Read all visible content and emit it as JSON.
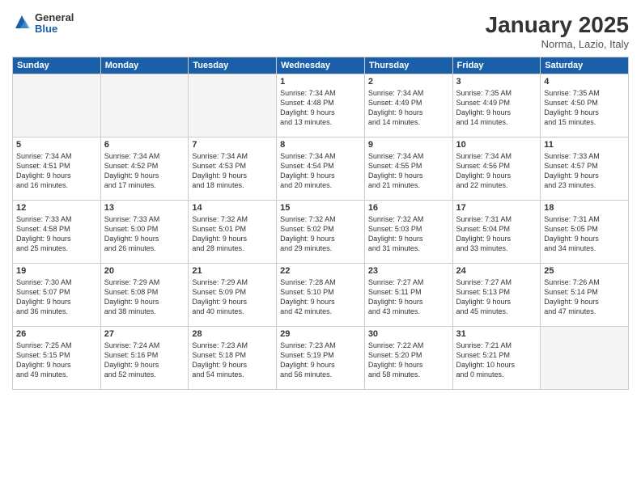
{
  "logo": {
    "general": "General",
    "blue": "Blue"
  },
  "title": "January 2025",
  "subtitle": "Norma, Lazio, Italy",
  "weekdays": [
    "Sunday",
    "Monday",
    "Tuesday",
    "Wednesday",
    "Thursday",
    "Friday",
    "Saturday"
  ],
  "weeks": [
    [
      {
        "day": "",
        "info": "",
        "empty": true
      },
      {
        "day": "",
        "info": "",
        "empty": true
      },
      {
        "day": "",
        "info": "",
        "empty": true
      },
      {
        "day": "1",
        "info": "Sunrise: 7:34 AM\nSunset: 4:48 PM\nDaylight: 9 hours\nand 13 minutes.",
        "empty": false
      },
      {
        "day": "2",
        "info": "Sunrise: 7:34 AM\nSunset: 4:49 PM\nDaylight: 9 hours\nand 14 minutes.",
        "empty": false
      },
      {
        "day": "3",
        "info": "Sunrise: 7:35 AM\nSunset: 4:49 PM\nDaylight: 9 hours\nand 14 minutes.",
        "empty": false
      },
      {
        "day": "4",
        "info": "Sunrise: 7:35 AM\nSunset: 4:50 PM\nDaylight: 9 hours\nand 15 minutes.",
        "empty": false
      }
    ],
    [
      {
        "day": "5",
        "info": "Sunrise: 7:34 AM\nSunset: 4:51 PM\nDaylight: 9 hours\nand 16 minutes.",
        "empty": false
      },
      {
        "day": "6",
        "info": "Sunrise: 7:34 AM\nSunset: 4:52 PM\nDaylight: 9 hours\nand 17 minutes.",
        "empty": false
      },
      {
        "day": "7",
        "info": "Sunrise: 7:34 AM\nSunset: 4:53 PM\nDaylight: 9 hours\nand 18 minutes.",
        "empty": false
      },
      {
        "day": "8",
        "info": "Sunrise: 7:34 AM\nSunset: 4:54 PM\nDaylight: 9 hours\nand 20 minutes.",
        "empty": false
      },
      {
        "day": "9",
        "info": "Sunrise: 7:34 AM\nSunset: 4:55 PM\nDaylight: 9 hours\nand 21 minutes.",
        "empty": false
      },
      {
        "day": "10",
        "info": "Sunrise: 7:34 AM\nSunset: 4:56 PM\nDaylight: 9 hours\nand 22 minutes.",
        "empty": false
      },
      {
        "day": "11",
        "info": "Sunrise: 7:33 AM\nSunset: 4:57 PM\nDaylight: 9 hours\nand 23 minutes.",
        "empty": false
      }
    ],
    [
      {
        "day": "12",
        "info": "Sunrise: 7:33 AM\nSunset: 4:58 PM\nDaylight: 9 hours\nand 25 minutes.",
        "empty": false
      },
      {
        "day": "13",
        "info": "Sunrise: 7:33 AM\nSunset: 5:00 PM\nDaylight: 9 hours\nand 26 minutes.",
        "empty": false
      },
      {
        "day": "14",
        "info": "Sunrise: 7:32 AM\nSunset: 5:01 PM\nDaylight: 9 hours\nand 28 minutes.",
        "empty": false
      },
      {
        "day": "15",
        "info": "Sunrise: 7:32 AM\nSunset: 5:02 PM\nDaylight: 9 hours\nand 29 minutes.",
        "empty": false
      },
      {
        "day": "16",
        "info": "Sunrise: 7:32 AM\nSunset: 5:03 PM\nDaylight: 9 hours\nand 31 minutes.",
        "empty": false
      },
      {
        "day": "17",
        "info": "Sunrise: 7:31 AM\nSunset: 5:04 PM\nDaylight: 9 hours\nand 33 minutes.",
        "empty": false
      },
      {
        "day": "18",
        "info": "Sunrise: 7:31 AM\nSunset: 5:05 PM\nDaylight: 9 hours\nand 34 minutes.",
        "empty": false
      }
    ],
    [
      {
        "day": "19",
        "info": "Sunrise: 7:30 AM\nSunset: 5:07 PM\nDaylight: 9 hours\nand 36 minutes.",
        "empty": false
      },
      {
        "day": "20",
        "info": "Sunrise: 7:29 AM\nSunset: 5:08 PM\nDaylight: 9 hours\nand 38 minutes.",
        "empty": false
      },
      {
        "day": "21",
        "info": "Sunrise: 7:29 AM\nSunset: 5:09 PM\nDaylight: 9 hours\nand 40 minutes.",
        "empty": false
      },
      {
        "day": "22",
        "info": "Sunrise: 7:28 AM\nSunset: 5:10 PM\nDaylight: 9 hours\nand 42 minutes.",
        "empty": false
      },
      {
        "day": "23",
        "info": "Sunrise: 7:27 AM\nSunset: 5:11 PM\nDaylight: 9 hours\nand 43 minutes.",
        "empty": false
      },
      {
        "day": "24",
        "info": "Sunrise: 7:27 AM\nSunset: 5:13 PM\nDaylight: 9 hours\nand 45 minutes.",
        "empty": false
      },
      {
        "day": "25",
        "info": "Sunrise: 7:26 AM\nSunset: 5:14 PM\nDaylight: 9 hours\nand 47 minutes.",
        "empty": false
      }
    ],
    [
      {
        "day": "26",
        "info": "Sunrise: 7:25 AM\nSunset: 5:15 PM\nDaylight: 9 hours\nand 49 minutes.",
        "empty": false
      },
      {
        "day": "27",
        "info": "Sunrise: 7:24 AM\nSunset: 5:16 PM\nDaylight: 9 hours\nand 52 minutes.",
        "empty": false
      },
      {
        "day": "28",
        "info": "Sunrise: 7:23 AM\nSunset: 5:18 PM\nDaylight: 9 hours\nand 54 minutes.",
        "empty": false
      },
      {
        "day": "29",
        "info": "Sunrise: 7:23 AM\nSunset: 5:19 PM\nDaylight: 9 hours\nand 56 minutes.",
        "empty": false
      },
      {
        "day": "30",
        "info": "Sunrise: 7:22 AM\nSunset: 5:20 PM\nDaylight: 9 hours\nand 58 minutes.",
        "empty": false
      },
      {
        "day": "31",
        "info": "Sunrise: 7:21 AM\nSunset: 5:21 PM\nDaylight: 10 hours\nand 0 minutes.",
        "empty": false
      },
      {
        "day": "",
        "info": "",
        "empty": true
      }
    ]
  ]
}
